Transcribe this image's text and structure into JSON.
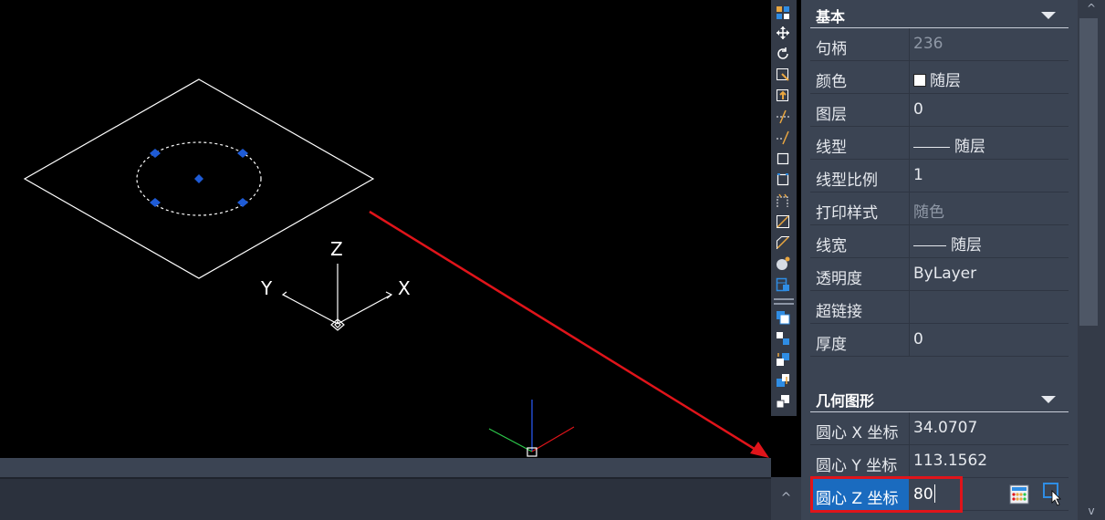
{
  "command_bar": {
    "scroll_glyph": "^"
  },
  "toolbar": {
    "icons": [
      "quick-select-icon",
      "move-icon",
      "rotate-icon",
      "scale-icon",
      "align-icon",
      "trim-icon",
      "extend-icon",
      "rectangle-icon",
      "rectangle-dashed-icon",
      "stretch-icon",
      "offset-icon",
      "chamfer-icon",
      "sphere-icon",
      "table-icon",
      "copy-layer-icon",
      "copy-objects-icon",
      "swap-order-icon",
      "bring-front-icon",
      "send-back-icon"
    ]
  },
  "palette": {
    "basic": {
      "title": "基本",
      "rows": [
        {
          "label": "句柄",
          "value": "236",
          "dim": true
        },
        {
          "label": "颜色",
          "value": "随层"
        },
        {
          "label": "图层",
          "value": "0"
        },
        {
          "label": "线型",
          "value": "随层"
        },
        {
          "label": "线型比例",
          "value": "1"
        },
        {
          "label": "打印样式",
          "value": "随色",
          "dim": true
        },
        {
          "label": "线宽",
          "value": "随层"
        },
        {
          "label": "透明度",
          "value": "ByLayer"
        },
        {
          "label": "超链接",
          "value": ""
        },
        {
          "label": "厚度",
          "value": "0"
        }
      ]
    },
    "geometry": {
      "title": "几何图形",
      "rows": [
        {
          "label": "圆心 X 坐标",
          "value": "34.0707"
        },
        {
          "label": "圆心 Y 坐标",
          "value": "113.1562"
        },
        {
          "label": "圆心 Z 坐标",
          "value": "80"
        }
      ]
    }
  },
  "ucs": {
    "z": "Z",
    "y": "Y",
    "x": "X"
  },
  "colors": {
    "annotation_red": "#e0141a",
    "grip_blue": "#1e5bd6",
    "selected_row": "#1a6bbf",
    "panel_bg": "#3b4453"
  },
  "scrollbar": {
    "up_glyph": "^",
    "down_glyph": "v"
  }
}
